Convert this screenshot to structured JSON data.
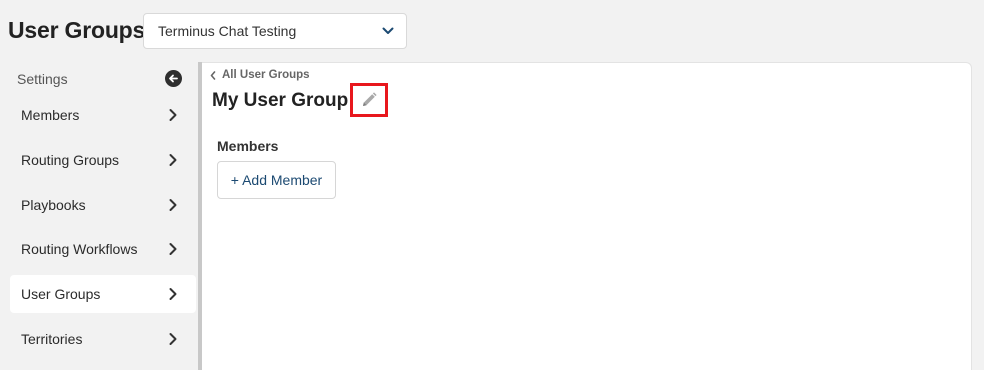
{
  "header": {
    "title": "User Groups",
    "workspace_selected": "Terminus Chat Testing"
  },
  "sidebar": {
    "heading": "Settings",
    "items": [
      {
        "label": "Members"
      },
      {
        "label": "Routing Groups"
      },
      {
        "label": "Playbooks"
      },
      {
        "label": "Routing Workflows"
      },
      {
        "label": "User Groups",
        "active": true
      },
      {
        "label": "Territories"
      }
    ]
  },
  "main": {
    "breadcrumb": "All User Groups",
    "group_name": "My User Group",
    "members_heading": "Members",
    "add_member_label": "+ Add Member"
  },
  "colors": {
    "highlight_border": "#e8171d",
    "link_text": "#1c4a72",
    "background": "#f2f2f2"
  },
  "icons": [
    "chevron-down-icon",
    "back-arrow-icon",
    "chevron-right-icon",
    "chevron-left-icon",
    "pencil-icon"
  ]
}
